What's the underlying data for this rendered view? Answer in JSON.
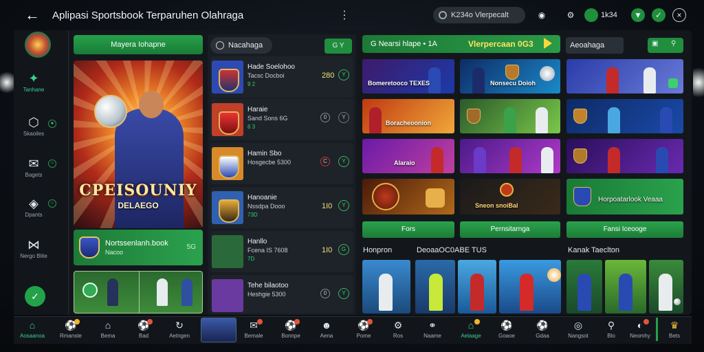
{
  "topbar": {
    "title": "Aplipasi Sportsbook Terparuhen Olahraga",
    "wallet_text": "K234o Vlerpecalt",
    "balance": "1k34",
    "icons": [
      "back-arrow-icon",
      "kebab-menu-icon",
      "robot-icon",
      "settings-icon",
      "trophy-icon",
      "download-icon",
      "close-icon"
    ]
  },
  "sidebar": {
    "items": [
      {
        "label": "Tanhane",
        "icon": "star-icon",
        "active": true
      },
      {
        "label": "Skaoiles",
        "icon": "hexagon-icon"
      },
      {
        "label": "Bagets",
        "icon": "chat-icon"
      },
      {
        "label": "Dpants",
        "icon": "shield-icon"
      },
      {
        "label": "Nergo Blite",
        "icon": "bowtie-icon"
      }
    ],
    "fab_icon": "check-icon"
  },
  "col1": {
    "top_button": "Mayera Iohapne",
    "hero_title": "CPEISOUNIY",
    "hero_subtitle": "DELAEGO",
    "promo_title": "Nortssenlanh.book",
    "promo_sub": "Nacoo",
    "promo_tag": "5G"
  },
  "col2": {
    "header": "Nacahaga",
    "header_button": "G Y",
    "rows": [
      {
        "name": "Hade Soelohoo",
        "sub": "Tacsc Docboi",
        "tag": "9 2",
        "odds": "280",
        "chip": "Y",
        "thumb": "#2d4ab3"
      },
      {
        "name": "Haraie",
        "sub": "Sand Sons 6G",
        "tag": "6 3",
        "odds": "",
        "chip": "Y",
        "chip2": "0",
        "thumb": "#c0402a"
      },
      {
        "name": "Hamin Sbo",
        "sub": "Hosgecbe 5300",
        "tag": "",
        "odds": "",
        "chip": "Y",
        "chip2": "C",
        "thumb": "#d68a2a"
      },
      {
        "name": "Hanoanie",
        "sub": "Nssdpa Dooo",
        "tag": "73D",
        "odds": "1I0",
        "chip": "Y",
        "thumb": "#3060b0"
      },
      {
        "name": "Hanllo",
        "sub": "Fcena IS 7608",
        "tag": "7D",
        "odds": "1I0",
        "chip": "G",
        "thumb": "#2a6a3a"
      },
      {
        "name": "Tehe bilaotoo",
        "sub": "Heshgie 5300",
        "tag": "",
        "odds": "",
        "chip": "Y",
        "chip2": "0",
        "thumb": "#6a3aa0"
      }
    ]
  },
  "main": {
    "header_left": "G Nearsi hlape • 1A",
    "header_promo": "Vlerpercaan 0G3",
    "side_header": "Aeoahaga",
    "tiles_row1": [
      "Bomeretooco TEXES",
      "Nonsecu Doioh",
      ""
    ],
    "tiles_row2": [
      "Boracheoonion",
      "",
      ""
    ],
    "tiles_row3": [
      "Alaraio",
      "",
      ""
    ],
    "tiles_row4": [
      "",
      "Sneon snoiBal",
      "Horpoatarlook Veaaa"
    ],
    "buttons": [
      "Fors",
      "Pernsitarnga",
      "Fansi Iceooge"
    ],
    "sections": [
      "Honpron",
      "DeoaaOC0ABE TUS",
      "Kanak Taeclton"
    ]
  },
  "bottombar": {
    "items": [
      "Aosaanoa",
      "Rmanste",
      "Bema",
      "Bad",
      "Aetngen",
      "",
      "Bemale",
      "Bonnpe",
      "Aena",
      "Pome",
      "Ros",
      "Naame",
      "Aelaage",
      "Goaoe",
      "Gdaa",
      "Nangsot",
      "Blo",
      "Neomhy",
      "Bets"
    ],
    "active_index": 0
  },
  "colors": {
    "accent_green": "#23a249",
    "odds_yellow": "#f2e27a",
    "promo_yellow": "#ffe55a",
    "panel_bg": "#13171c"
  }
}
